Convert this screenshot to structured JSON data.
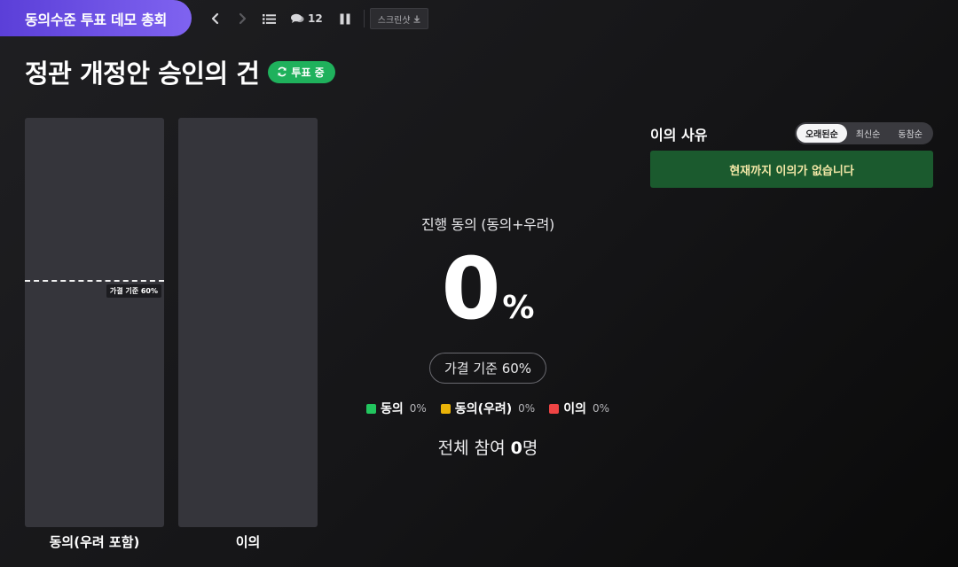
{
  "header": {
    "event_title": "동의수준 투표 데모 총회",
    "comment_count": "12",
    "screenshot_label": "스크린샷"
  },
  "agenda": {
    "title": "정관 개정안 승인의 건",
    "status_badge": "투표 중"
  },
  "bars": {
    "threshold_percent": 60,
    "threshold_tag": "가결 기준 60%",
    "agree": {
      "label": "동의(우려 포함)",
      "fill_percent": 0
    },
    "disagree": {
      "label": "이의",
      "fill_percent": 0
    }
  },
  "stats": {
    "progress_label": "진행 동의 (동의+우려)",
    "progress_value": "0",
    "progress_unit": "%",
    "threshold_pill": "가결 기준 60%",
    "legend": [
      {
        "name": "동의",
        "pct": "0%",
        "color": "#22c55e"
      },
      {
        "name": "동의(우려)",
        "pct": "0%",
        "color": "#eab308"
      },
      {
        "name": "이의",
        "pct": "0%",
        "color": "#ef4444"
      }
    ],
    "total_prefix": "전체 참여 ",
    "total_count": "0",
    "total_suffix": "명"
  },
  "reasons": {
    "title": "이의 사유",
    "sort_tabs": [
      {
        "label": "오래된순",
        "active": true
      },
      {
        "label": "최신순",
        "active": false
      },
      {
        "label": "동참순",
        "active": false
      }
    ],
    "empty_message": "현재까지 이의가 없습니다"
  },
  "colors": {
    "accent_purple": "#6b4fe6",
    "status_green": "#1fb15c",
    "empty_box_bg": "#1b5a2e",
    "empty_box_text": "#f2e7a6"
  }
}
